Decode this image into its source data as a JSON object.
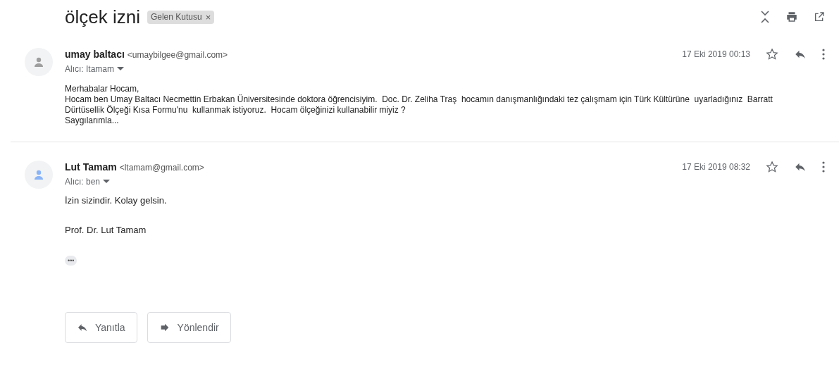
{
  "subject": "ölçek izni",
  "label": {
    "text": "Gelen Kutusu",
    "close": "×"
  },
  "messages": [
    {
      "sender": "umay baltacı",
      "email": "<umaybilgee@gmail.com>",
      "to": "Alıcı: Itamam",
      "date": "17 Eki 2019 00:13",
      "color": "#9e9e9e",
      "starred": false,
      "kind": "compact",
      "body": [
        "Merhabalar Hocam,",
        "Hocam ben Umay Baltacı Necmettin Erbakan Üniversitesinde doktora öğrencisiyim.  Doc. Dr. Zeliha Traş  hocamın danışmanlığındaki tez çalışmam için Türk Kültürüne  uyarladığınız  Barratt Dürtüsellik Ölçeği Kısa Formu'nu  kullanmak istiyoruz.  Hocam ölçeğinizi kullanabilir miyiz ?",
        "Saygılarımla..."
      ]
    },
    {
      "sender": "Lut Tamam",
      "email": "<ltamam@gmail.com>",
      "to": "Alıcı: ben",
      "date": "17 Eki 2019 08:32",
      "color": "#8ab4f8",
      "starred": false,
      "kind": "spaced",
      "body": [
        "İzin sizindir. Kolay gelsin.",
        "Prof. Dr. Lut Tamam"
      ],
      "more": "•••"
    }
  ],
  "actions": [
    {
      "label": "Yanıtla",
      "kind": "reply"
    },
    {
      "label": "Yönlendir",
      "kind": "forward"
    }
  ]
}
